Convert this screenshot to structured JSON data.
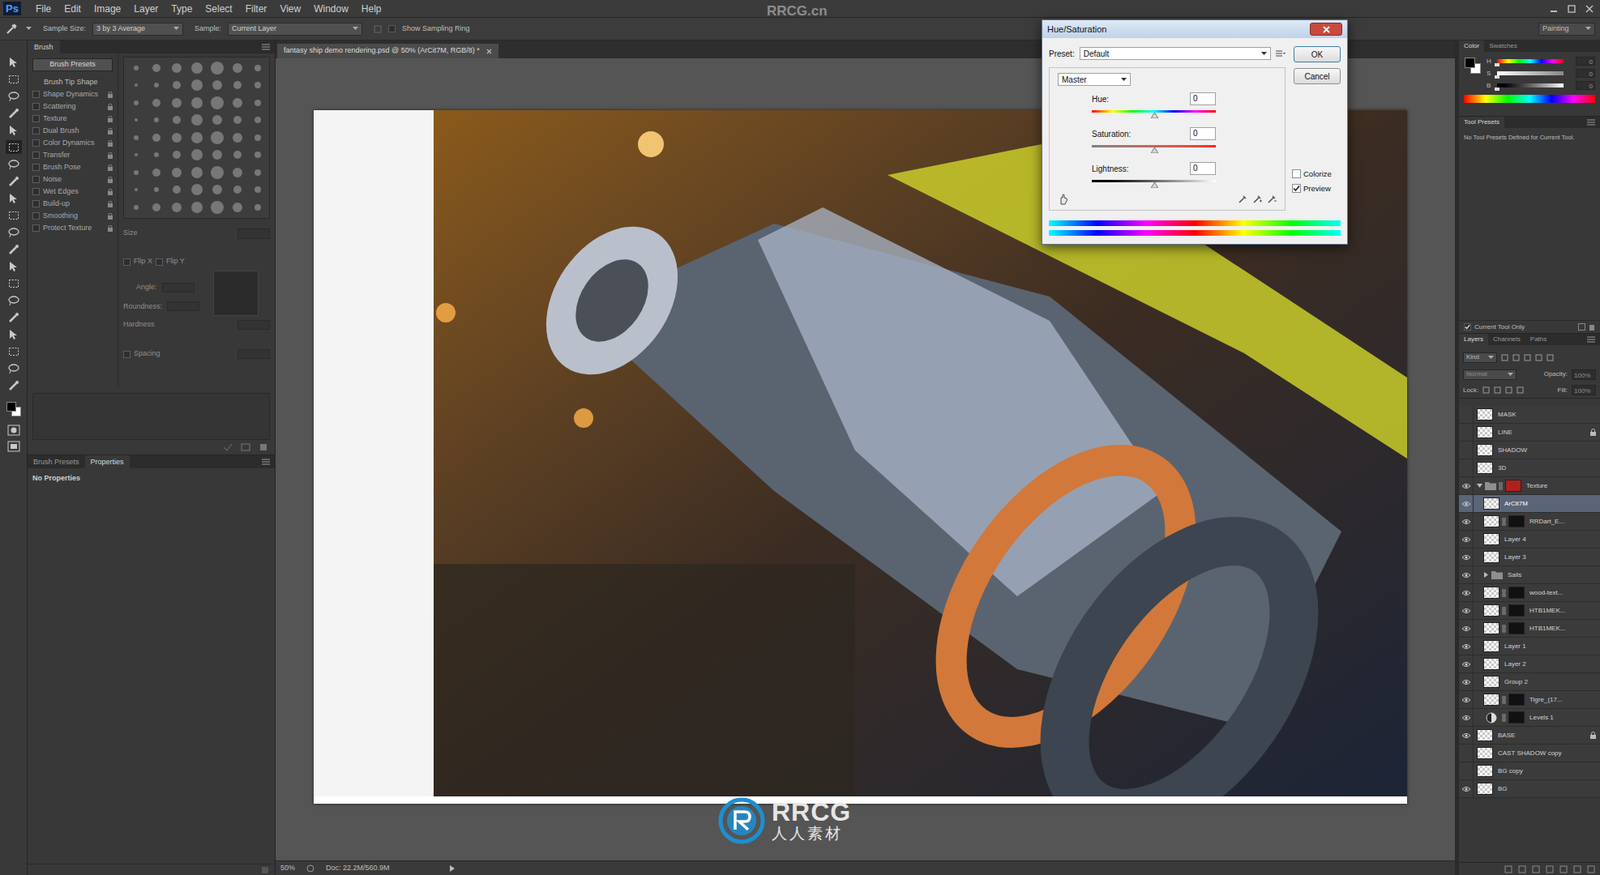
{
  "app": {
    "logo": "Ps",
    "menu": [
      "File",
      "Edit",
      "Image",
      "Layer",
      "Type",
      "Select",
      "Filter",
      "View",
      "Window",
      "Help"
    ],
    "watermark": "RRCG.cn",
    "workspace": "Painting"
  },
  "options_bar": {
    "sample_size_label": "Sample Size:",
    "sample_size": "3 by 3 Average",
    "sample_label": "Sample:",
    "sample": "Current Layer",
    "sampling_ring": {
      "label": "Show Sampling Ring",
      "checked": false
    }
  },
  "brush_panel": {
    "tab": "Brush",
    "presets_button": "Brush Presets",
    "tip_shape": "Brush Tip Shape",
    "options": [
      {
        "label": "Shape Dynamics",
        "checked": false
      },
      {
        "label": "Scattering",
        "checked": false
      },
      {
        "label": "Texture",
        "checked": false
      },
      {
        "label": "Dual Brush",
        "checked": false
      },
      {
        "label": "Color Dynamics",
        "checked": false
      },
      {
        "label": "Transfer",
        "checked": false
      },
      {
        "label": "Brush Pose",
        "checked": false
      },
      {
        "label": "Noise",
        "checked": false
      },
      {
        "label": "Wet Edges",
        "checked": false
      },
      {
        "label": "Build-up",
        "checked": false
      },
      {
        "label": "Smoothing",
        "checked": false
      },
      {
        "label": "Protect Texture",
        "checked": false
      }
    ],
    "size_label": "Size",
    "flip_x": {
      "label": "Flip X",
      "checked": false
    },
    "flip_y": {
      "label": "Flip Y",
      "checked": false
    },
    "angle_label": "Angle:",
    "roundness_label": "Roundness:",
    "hardness_label": "Hardness",
    "spacing": {
      "label": "Spacing",
      "checked": false
    }
  },
  "properties_panel": {
    "tabs": [
      {
        "label": "Brush Presets",
        "selected": false
      },
      {
        "label": "Properties",
        "selected": true
      }
    ],
    "message": "No Properties"
  },
  "document": {
    "tab": "fantasy ship demo rendering.psd @ 50% (ArCit7M, RGB/8) *",
    "zoom": "50%",
    "doc_info": "Doc: 22.2M/560.9M"
  },
  "dialog": {
    "title": "Hue/Saturation",
    "preset_label": "Preset:",
    "preset": "Default",
    "buttons": [
      "OK",
      "Cancel"
    ],
    "channel": "Master",
    "sliders": [
      {
        "label": "Hue:",
        "value": "0",
        "level": 0.5,
        "kind": "hue"
      },
      {
        "label": "Saturation:",
        "value": "0",
        "level": 0.5,
        "kind": "saturation"
      },
      {
        "label": "Lightness:",
        "value": "0",
        "level": 0.5,
        "kind": "lightness"
      }
    ],
    "options": [
      {
        "label": "Colorize",
        "checked": false
      },
      {
        "label": "Preview",
        "checked": true
      }
    ]
  },
  "color_panel": {
    "tabs": [
      {
        "label": "Color",
        "selected": true
      },
      {
        "label": "Swatches",
        "selected": false
      }
    ],
    "sliders": [
      {
        "label": "H",
        "value": "0",
        "level": 0,
        "kind": "hue"
      },
      {
        "label": "S",
        "value": "0",
        "level": 0,
        "kind": "saturation"
      },
      {
        "label": "B",
        "value": "0",
        "level": 0,
        "kind": "brightness"
      }
    ]
  },
  "tool_presets": {
    "title": "Tool Presets",
    "message": "No Tool Presets Defined for Current Tool.",
    "current_tool_only": {
      "label": "Current Tool Only",
      "checked": true
    }
  },
  "layers_panel": {
    "tabs": [
      {
        "label": "Layers",
        "selected": true
      },
      {
        "label": "Channels",
        "selected": false
      },
      {
        "label": "Paths",
        "selected": false
      }
    ],
    "filter": "Kind",
    "blend_mode": "Normal",
    "opacity_label": "Opacity:",
    "opacity": "100%",
    "lock_label": "Lock:",
    "fill_label": "Fill:",
    "fill": "100%",
    "layers": [
      {
        "name": "MASK",
        "kind": "layer",
        "visible": false,
        "selected": false,
        "in_group": false,
        "has_mask": false,
        "locked": false,
        "expanded": false
      },
      {
        "name": "LINE",
        "kind": "layer",
        "visible": false,
        "selected": false,
        "in_group": false,
        "has_mask": false,
        "locked": true,
        "expanded": false
      },
      {
        "name": "SHADOW",
        "kind": "layer",
        "visible": false,
        "selected": false,
        "in_group": false,
        "has_mask": false,
        "locked": false,
        "expanded": false
      },
      {
        "name": "3D",
        "kind": "layer",
        "visible": false,
        "selected": false,
        "in_group": false,
        "has_mask": false,
        "locked": false,
        "expanded": false
      },
      {
        "name": "Texture",
        "kind": "group",
        "visible": true,
        "selected": false,
        "in_group": false,
        "has_mask": true,
        "locked": false,
        "expanded": true
      },
      {
        "name": "ArCit7M",
        "kind": "layer",
        "visible": true,
        "selected": true,
        "in_group": true,
        "has_mask": false,
        "locked": false,
        "expanded": false
      },
      {
        "name": "RRDart_E...",
        "kind": "layer",
        "visible": true,
        "selected": false,
        "in_group": true,
        "has_mask": true,
        "locked": false,
        "expanded": false
      },
      {
        "name": "Layer 4",
        "kind": "layer",
        "visible": true,
        "selected": false,
        "in_group": true,
        "has_mask": false,
        "locked": false,
        "expanded": false
      },
      {
        "name": "Layer 3",
        "kind": "layer",
        "visible": true,
        "selected": false,
        "in_group": true,
        "has_mask": false,
        "locked": false,
        "expanded": false
      },
      {
        "name": "Sails",
        "kind": "group",
        "visible": true,
        "selected": false,
        "in_group": true,
        "has_mask": false,
        "locked": false,
        "expanded": false
      },
      {
        "name": "wood-text...",
        "kind": "layer",
        "visible": true,
        "selected": false,
        "in_group": true,
        "has_mask": true,
        "locked": false,
        "expanded": false
      },
      {
        "name": "HTB1MEK...",
        "kind": "layer",
        "visible": true,
        "selected": false,
        "in_group": true,
        "has_mask": true,
        "locked": false,
        "expanded": false
      },
      {
        "name": "HTB1MEK...",
        "kind": "layer",
        "visible": true,
        "selected": false,
        "in_group": true,
        "has_mask": true,
        "locked": false,
        "expanded": false
      },
      {
        "name": "Layer 1",
        "kind": "layer",
        "visible": true,
        "selected": false,
        "in_group": true,
        "has_mask": false,
        "locked": false,
        "expanded": false
      },
      {
        "name": "Layer 2",
        "kind": "layer",
        "visible": true,
        "selected": false,
        "in_group": true,
        "has_mask": false,
        "locked": false,
        "expanded": false
      },
      {
        "name": "Group 2",
        "kind": "layer",
        "visible": true,
        "selected": false,
        "in_group": true,
        "has_mask": false,
        "locked": false,
        "expanded": false
      },
      {
        "name": "Tigre_(17...",
        "kind": "layer",
        "visible": true,
        "selected": false,
        "in_group": true,
        "has_mask": true,
        "locked": false,
        "expanded": false
      },
      {
        "name": "Levels 1",
        "kind": "adjustment",
        "visible": true,
        "selected": false,
        "in_group": true,
        "has_mask": true,
        "locked": false,
        "expanded": false
      },
      {
        "name": "BASE",
        "kind": "layer",
        "visible": true,
        "selected": false,
        "in_group": false,
        "has_mask": false,
        "locked": true,
        "expanded": false
      },
      {
        "name": "CAST SHADOW copy",
        "kind": "layer",
        "visible": false,
        "selected": false,
        "in_group": false,
        "has_mask": false,
        "locked": false,
        "expanded": false
      },
      {
        "name": "BG copy",
        "kind": "layer",
        "visible": false,
        "selected": false,
        "in_group": false,
        "has_mask": false,
        "locked": false,
        "expanded": false
      },
      {
        "name": "BG",
        "kind": "layer",
        "visible": true,
        "selected": false,
        "in_group": false,
        "has_mask": false,
        "locked": false,
        "expanded": false
      }
    ]
  },
  "bottom_logo": {
    "brand": "RRCG",
    "subtitle": "人人素材"
  }
}
